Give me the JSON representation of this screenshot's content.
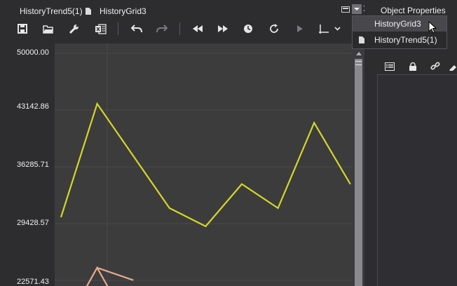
{
  "tabs": [
    {
      "label": "HistoryTrend5(1)",
      "active": true
    },
    {
      "label": "HistoryGrid3",
      "active": false
    }
  ],
  "toolbar": {
    "icons": [
      "save-icon",
      "open-folder-icon",
      "wrench-icon",
      "excel-export-icon",
      "undo-icon",
      "redo-icon",
      "rewind-icon",
      "fast-forward-icon",
      "clock-icon",
      "refresh-icon",
      "play-icon",
      "axis-icon",
      "chevron-down-icon"
    ]
  },
  "chart": {
    "y_ticks": [
      "50000.00",
      "43142.86",
      "36285.71",
      "29428.57",
      "22571.43"
    ]
  },
  "chart_data": {
    "type": "line",
    "ylim": [
      22571.43,
      50000.0
    ],
    "y_ticks": [
      50000.0,
      43142.86,
      36285.71,
      29428.57,
      22571.43
    ],
    "grid": true,
    "x": [
      0,
      1,
      2,
      3,
      4,
      5,
      6,
      7,
      8
    ],
    "series": [
      {
        "color": "#d4d62a",
        "values": [
          30200,
          43900,
          37600,
          31300,
          29100,
          34200,
          31300,
          41600,
          34200
        ]
      },
      {
        "color": "#e8a890",
        "values": [
          null,
          24100,
          22600,
          null,
          null,
          null,
          null,
          null,
          null
        ]
      }
    ]
  },
  "props_panel": {
    "title": "Object Properties",
    "icons": [
      "list-icon",
      "lock-icon",
      "link-icon",
      "tag-icon"
    ]
  },
  "dropdown": {
    "items": [
      {
        "label": "HistoryGrid3",
        "highlighted": true,
        "icon": ""
      },
      {
        "label": "HistoryTrend5(1)",
        "highlighted": false,
        "icon": "file-icon"
      }
    ]
  },
  "colors": {
    "background": "#2d2d30",
    "plot_background": "#3c3c3c",
    "gridline": "#4a4a4a",
    "series_primary": "#d4d62a",
    "series_secondary": "#e8a890"
  }
}
